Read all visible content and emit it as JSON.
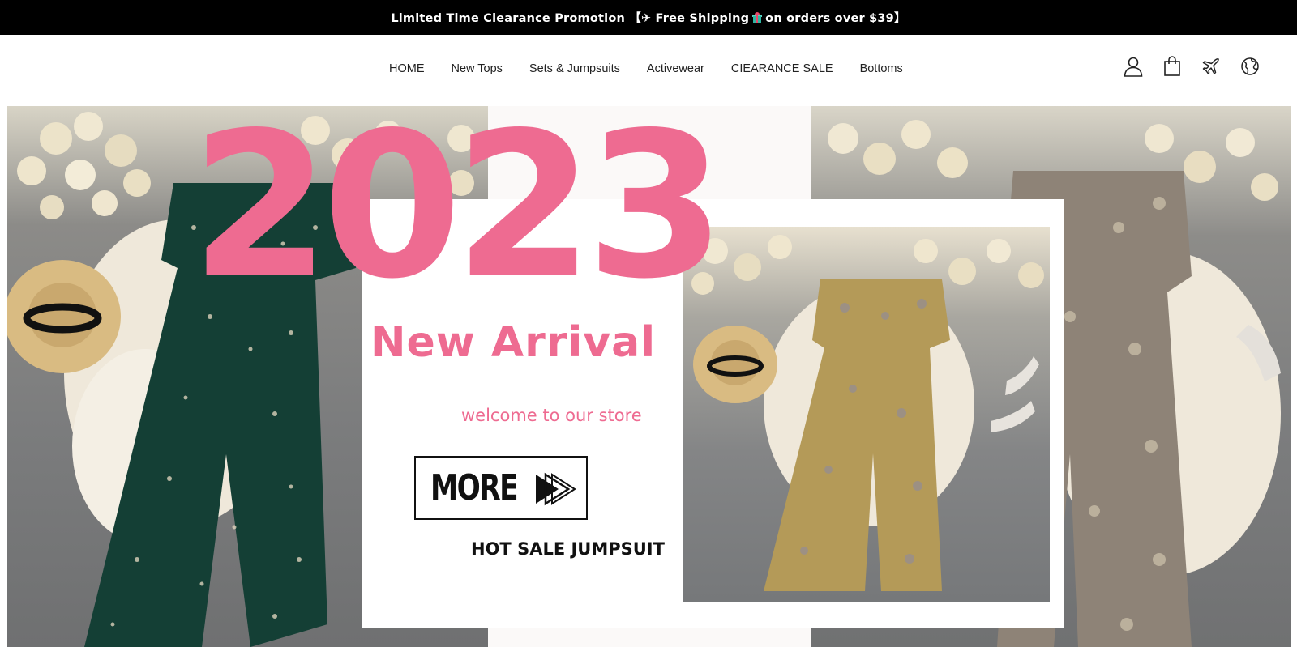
{
  "announcement": {
    "text_before": "Limited Time Clearance Promotion 【✈ Free Shipping",
    "text_after": "on orders over $39】",
    "icon": "gift-icon"
  },
  "nav": {
    "items": [
      {
        "label": "HOME"
      },
      {
        "label": "New Tops"
      },
      {
        "label": "Sets & Jumpsuits"
      },
      {
        "label": "Activewear"
      },
      {
        "label": "CIEARANCE SALE"
      },
      {
        "label": "Bottoms"
      }
    ]
  },
  "header_icons": [
    "user-icon",
    "shopping-bag-icon",
    "airplane-icon",
    "globe-icon"
  ],
  "hero": {
    "year": "2023",
    "headline": "New Arrival",
    "subtitle": "welcome to our store",
    "button_label": "MORE",
    "tagline": "HOT SALE JUMPSUIT",
    "accent_color": "#ee6b91"
  }
}
